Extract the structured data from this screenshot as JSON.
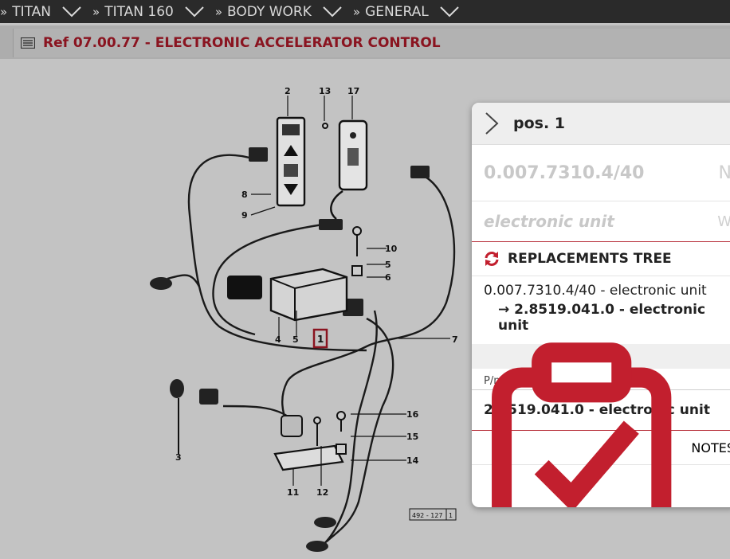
{
  "breadcrumb": {
    "items": [
      {
        "label": "TITAN"
      },
      {
        "label": "TITAN 160"
      },
      {
        "label": "BODY WORK"
      },
      {
        "label": "GENERAL"
      }
    ]
  },
  "page": {
    "title": "Ref 07.00.77 - ELECTRONIC ACCELERATOR CONTROL"
  },
  "diagram": {
    "labels": [
      "2",
      "13",
      "17",
      "8",
      "9",
      "10",
      "5",
      "6",
      "4",
      "5",
      "1",
      "7",
      "16",
      "15",
      "14",
      "3",
      "11",
      "12"
    ],
    "plate": "492 - 127"
  },
  "panel": {
    "title": "pos. 1",
    "code": "0.007.7310.4/40",
    "code_trunc": "N",
    "description": "electronic unit",
    "description_trunc": "W",
    "replacements": {
      "title": "REPLACEMENTS TREE",
      "row1": "0.007.7310.4/40 - electronic unit",
      "row2": "2.8519.041.0 - electronic unit"
    },
    "pn_label": "P/n",
    "pn_value": "2.8519.041.0 - electronic unit",
    "notes_title": "NOTES"
  },
  "colors": {
    "accent": "#c21f2e",
    "title_red": "#8a1420"
  }
}
